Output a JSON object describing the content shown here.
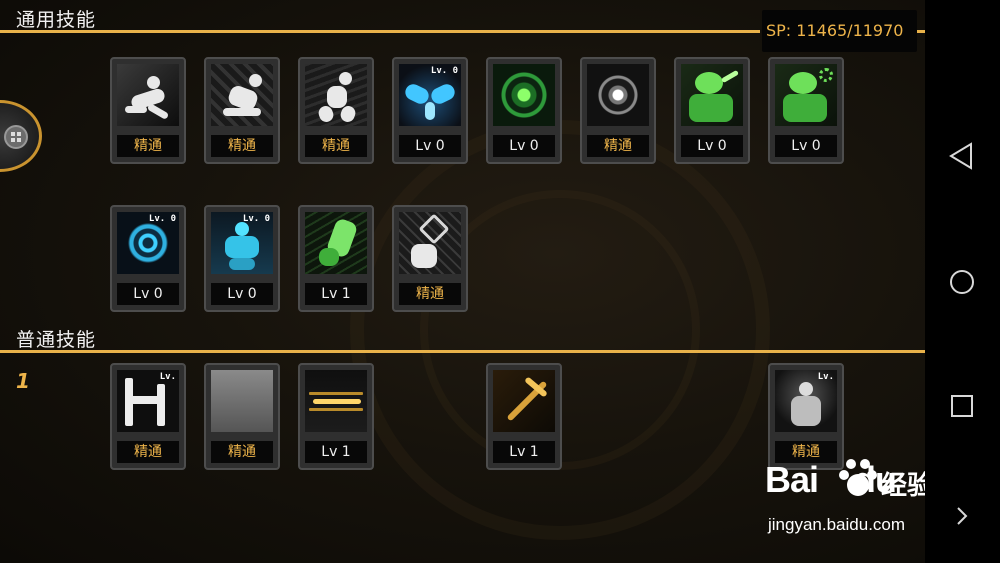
{
  "header": {
    "general_title": "通用技能",
    "normal_title": "普通技能",
    "sp": "SP: 11465/11970"
  },
  "normal_row_number": "1",
  "general_skills": [
    {
      "icon": "crouch-figure-icon",
      "label": "精通",
      "mastered": true
    },
    {
      "icon": "kneel-figure-icon",
      "label": "精通",
      "mastered": true
    },
    {
      "icon": "dash-figure-icon",
      "label": "精通",
      "mastered": true
    },
    {
      "icon": "blue-wings-icon",
      "label": "Lv 0",
      "mastered": false,
      "badge": "Lv. 0"
    },
    {
      "icon": "green-crosshair-icon",
      "label": "Lv 0",
      "mastered": false
    },
    {
      "icon": "white-crosshair-icon",
      "label": "精通",
      "mastered": true
    },
    {
      "icon": "green-mage-icon",
      "label": "Lv 0",
      "mastered": false
    },
    {
      "icon": "green-mage-gear-icon",
      "label": "Lv 0",
      "mastered": false
    },
    {
      "icon": "blue-eye-icon",
      "label": "Lv 0",
      "mastered": false,
      "badge": "Lv. 0"
    },
    {
      "icon": "blue-body-icon",
      "label": "Lv 0",
      "mastered": false,
      "badge": "Lv. 0"
    },
    {
      "icon": "green-beast-icon",
      "label": "Lv 1",
      "mastered": false
    },
    {
      "icon": "hexagram-fist-icon",
      "label": "精通",
      "mastered": true
    }
  ],
  "normal_skills": [
    {
      "icon": "white-rune-icon",
      "label": "精通",
      "mastered": true,
      "badge": "Lv."
    },
    {
      "icon": "blank-skill-icon",
      "label": "精通",
      "mastered": true
    },
    {
      "icon": "golden-slash-icon",
      "label": "Lv 1",
      "mastered": false
    },
    {
      "icon": "golden-scythe-icon",
      "label": "Lv 1",
      "mastered": false
    },
    {
      "icon": "gray-figure-icon",
      "label": "精通",
      "mastered": true,
      "badge": "Lv."
    }
  ],
  "colors": {
    "accent": "#e9b24a",
    "label_gold": "#eeb44a",
    "label_white": "#f0f0f0"
  },
  "watermark": {
    "logo": "Bai",
    "logo2": "du",
    "text": "经验",
    "url": "jingyan.baidu.com"
  }
}
